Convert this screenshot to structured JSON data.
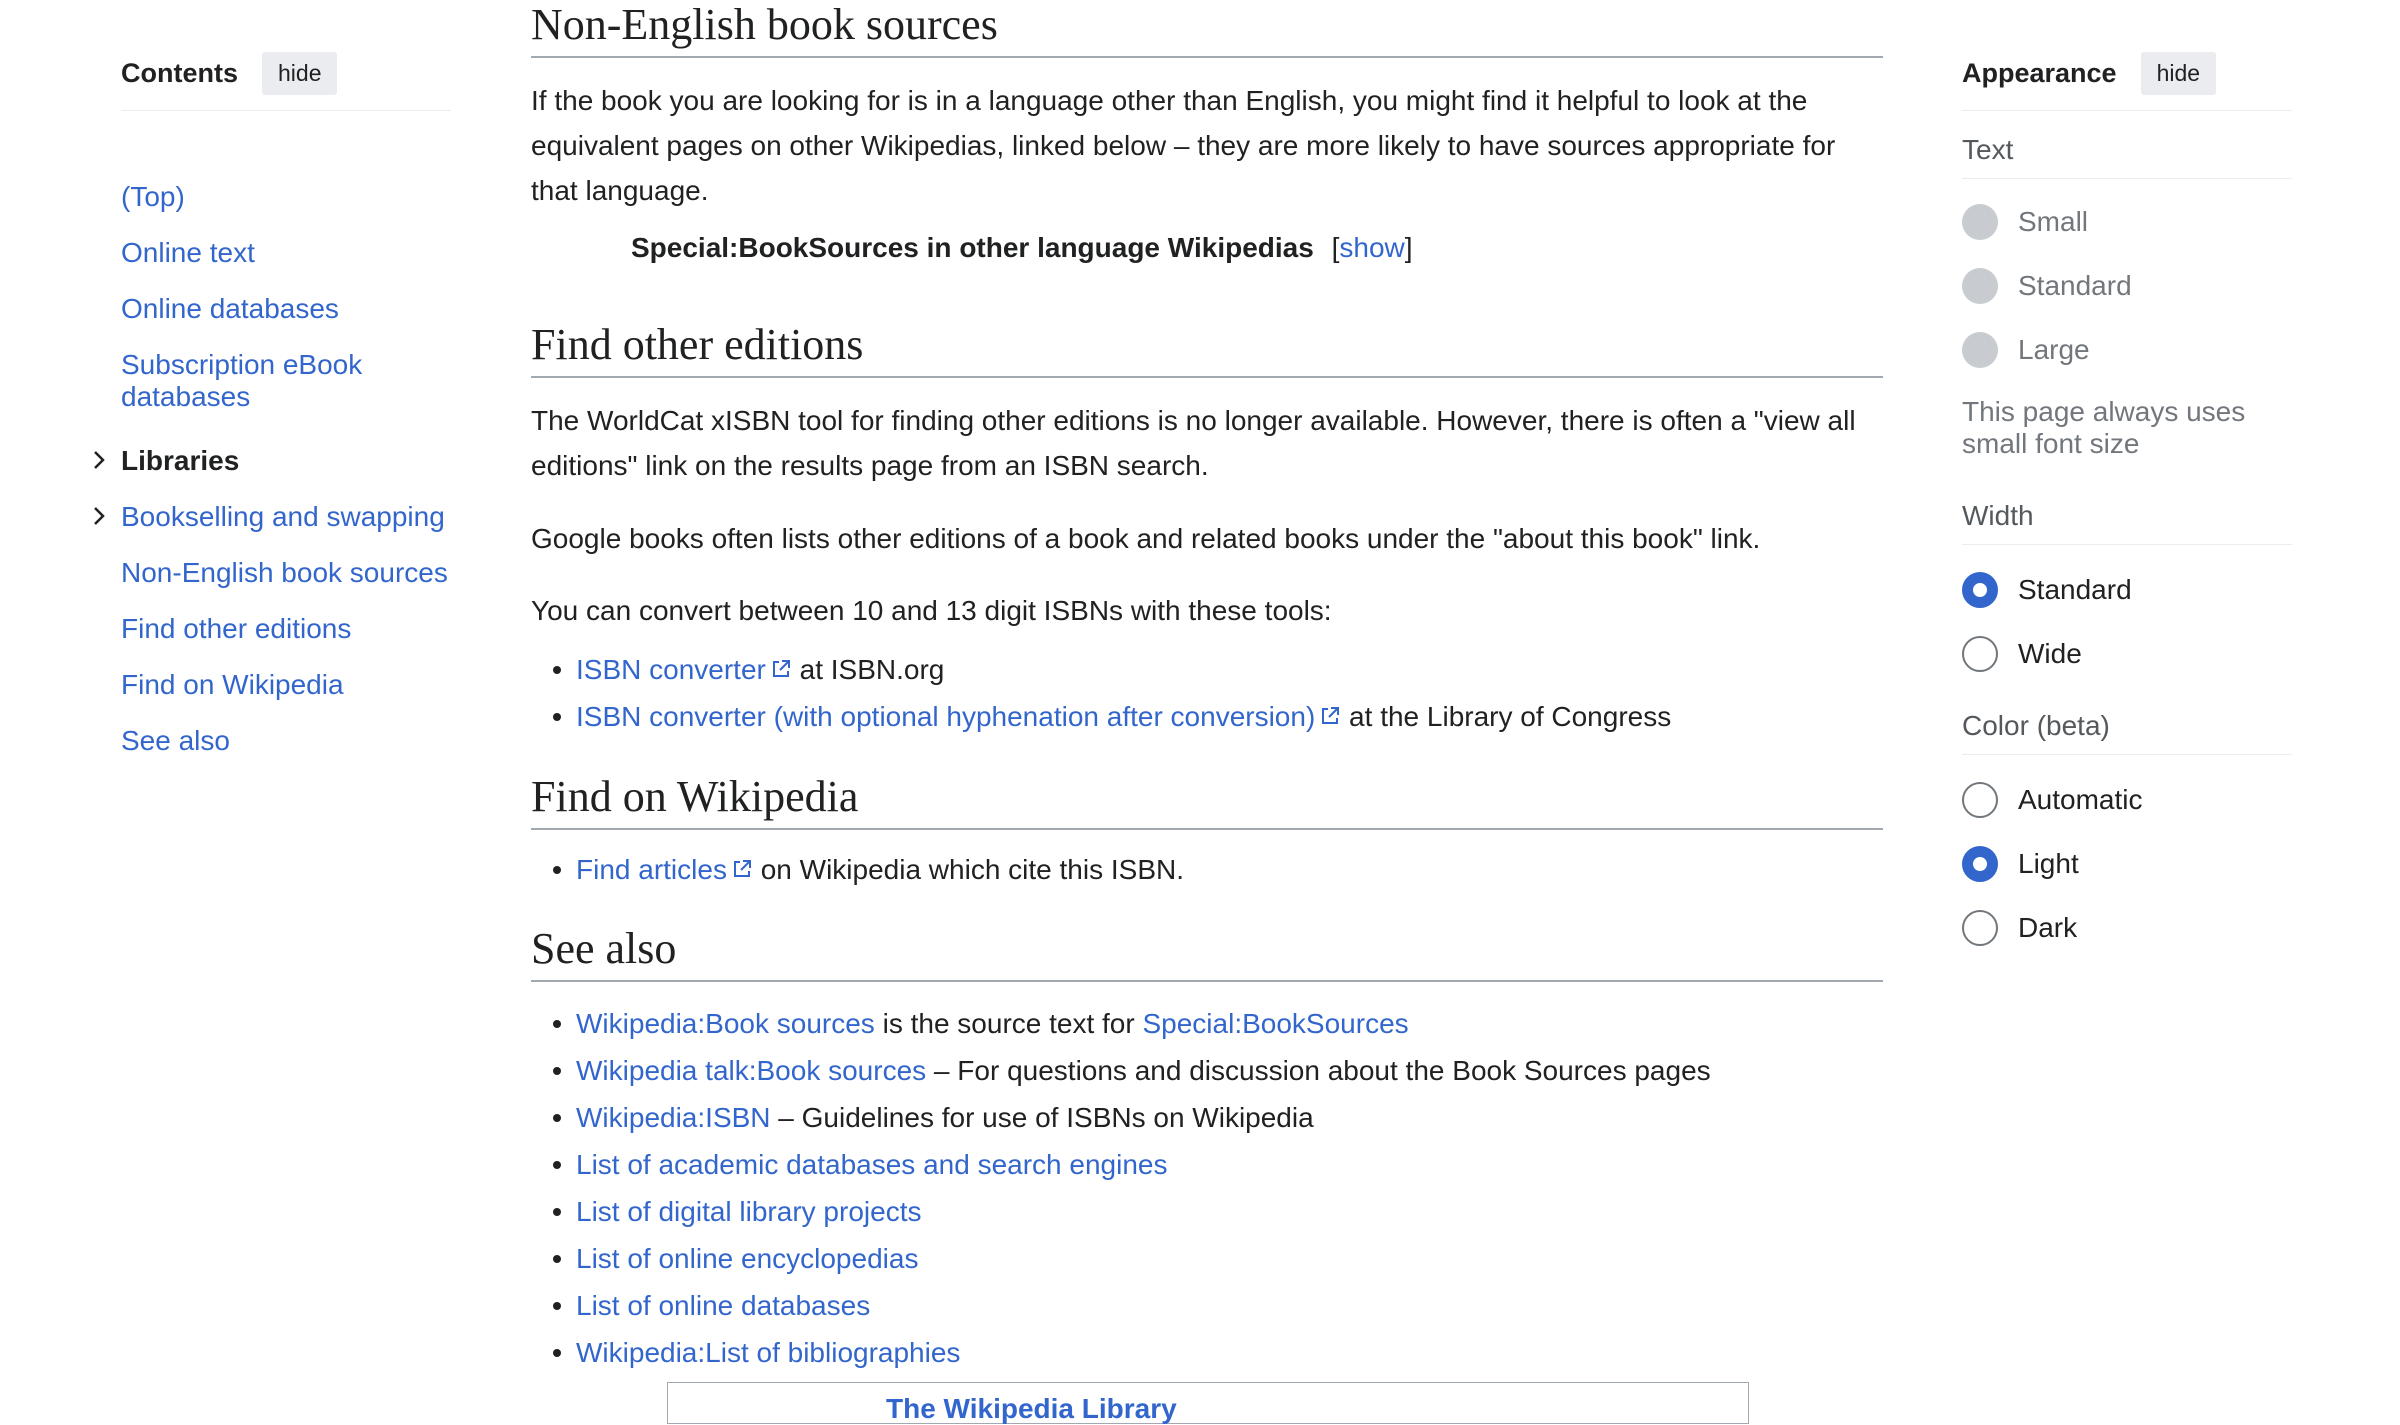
{
  "toc": {
    "title": "Contents",
    "hide_label": "hide",
    "items": [
      {
        "label": "(Top)"
      },
      {
        "label": "Online text"
      },
      {
        "label": "Online databases"
      },
      {
        "label": "Subscription eBook databases"
      },
      {
        "label": "Libraries"
      },
      {
        "label": "Bookselling and swapping"
      },
      {
        "label": "Non-English book sources"
      },
      {
        "label": "Find other editions"
      },
      {
        "label": "Find on Wikipedia"
      },
      {
        "label": "See also"
      }
    ]
  },
  "main": {
    "non_english": {
      "heading": "Non-English book sources",
      "para": "If the book you are looking for is in a language other than English, you might find it helpful to look at the equivalent pages on other Wikipedias, linked below – they are more likely to have sources appropriate for that language.",
      "box_title": "Special:BookSources in other language Wikipedias",
      "box_open": "[",
      "box_show": "show",
      "box_close": "]"
    },
    "other_editions": {
      "heading": "Find other editions",
      "para1": "The WorldCat xISBN tool for finding other editions is no longer available. However, there is often a \"view all editions\" link on the results page from an ISBN search.",
      "para2": "Google books often lists other editions of a book and related books under the \"about this book\" link.",
      "para3": "You can convert between 10 and 13 digit ISBNs with these tools:",
      "links": [
        {
          "link": "ISBN converter",
          "rest": " at ISBN.org"
        },
        {
          "link": "ISBN converter (with optional hyphenation after conversion)",
          "rest": " at the Library of Congress"
        }
      ]
    },
    "find_on_wikipedia": {
      "heading": "Find on Wikipedia",
      "link": "Find articles",
      "rest": " on Wikipedia which cite this ISBN."
    },
    "see_also": {
      "heading": "See also",
      "item1_link": "Wikipedia:Book sources",
      "item1_mid": " is the source text for ",
      "item1_link2": "Special:BookSources",
      "item2_link": "Wikipedia talk:Book sources",
      "item2_rest": " – For questions and discussion about the Book Sources pages",
      "item3_link": "Wikipedia:ISBN",
      "item3_rest": " – Guidelines for use of ISBNs on Wikipedia",
      "items": [
        "List of academic databases and search engines",
        "List of digital library projects",
        "List of online encyclopedias",
        "List of online databases",
        "Wikipedia:List of bibliographies"
      ]
    },
    "navbox_title": "The Wikipedia Library"
  },
  "appearance": {
    "title": "Appearance",
    "hide_label": "hide",
    "text_label": "Text",
    "text_options": [
      "Small",
      "Standard",
      "Large"
    ],
    "text_note": "This page always uses small font size",
    "width_label": "Width",
    "width_options": [
      "Standard",
      "Wide"
    ],
    "width_selected": "Standard",
    "color_label": "Color (beta)",
    "color_options": [
      "Automatic",
      "Light",
      "Dark"
    ],
    "color_selected": "Light"
  },
  "colors": {
    "link": "#3366cc",
    "text": "#202122",
    "muted": "#54595d"
  }
}
